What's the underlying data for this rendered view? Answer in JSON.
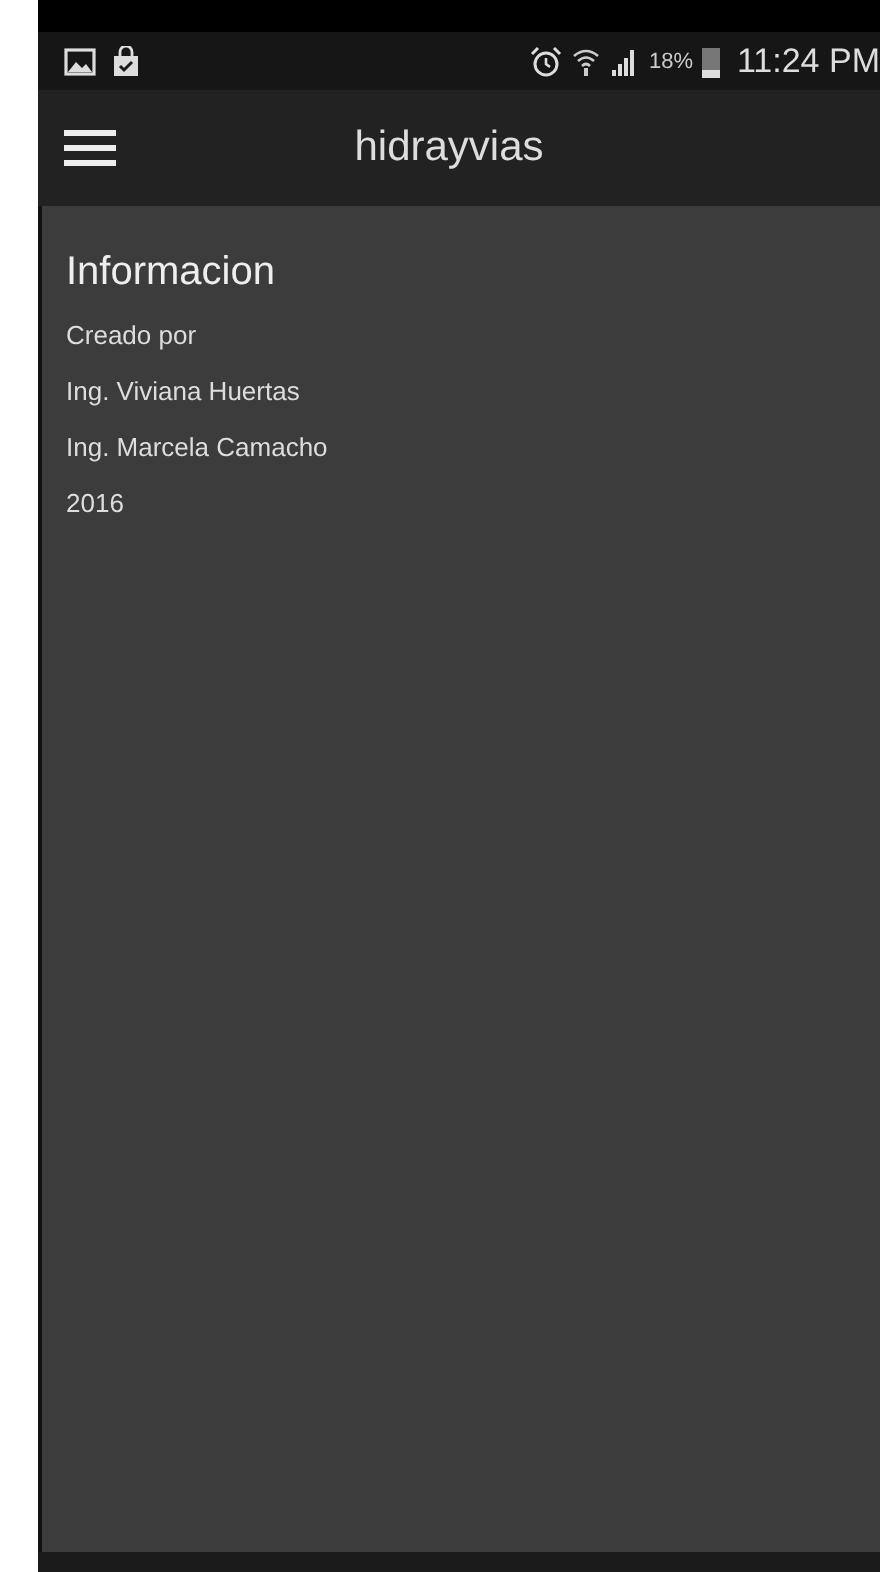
{
  "status_bar": {
    "battery": "18%",
    "time": "11:24 PM"
  },
  "toolbar": {
    "title": "hidrayvias"
  },
  "content": {
    "heading": "Informacion",
    "lines": [
      "Creado por",
      "Ing. Viviana Huertas",
      "Ing. Marcela Camacho",
      "2016"
    ]
  }
}
